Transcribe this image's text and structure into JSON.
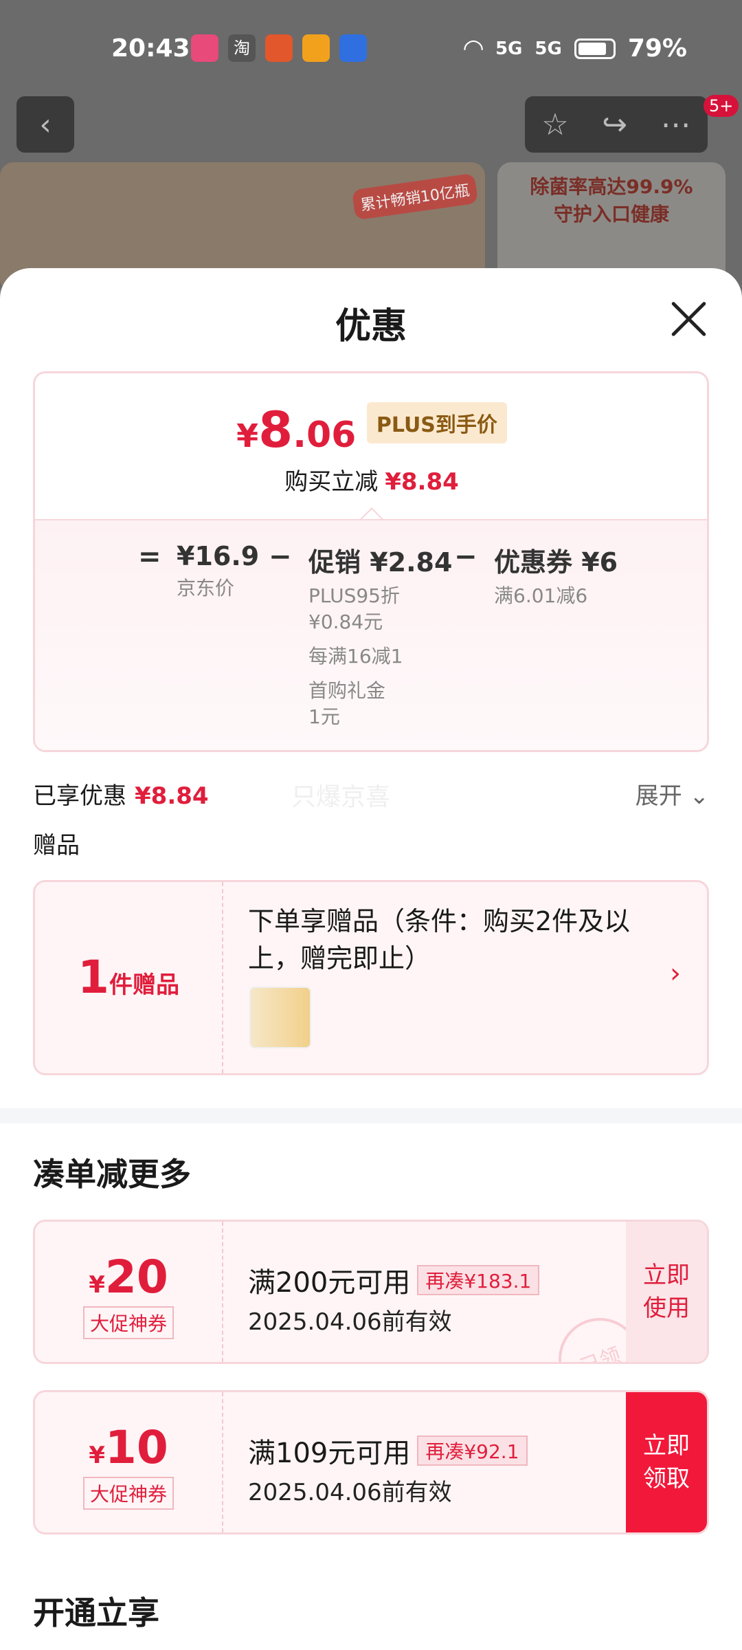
{
  "status": {
    "time": "20:43",
    "signal1": "5G",
    "signal2": "5G",
    "battery": "79%"
  },
  "background": {
    "badge": "5+",
    "banner_tag": "累计畅销10亿瓶",
    "banner_right_line1": "除菌率高达99.9%",
    "banner_right_line2": "守护入口健康"
  },
  "sheet": {
    "title": "优惠",
    "final_price": {
      "currency": "¥",
      "int": "8",
      "dec": ".06",
      "tag": "PLUS到手价"
    },
    "reduce_label": "购买立减",
    "reduce_amount": "¥8.84",
    "breakdown": {
      "eq": "=",
      "jd_price": "¥16.9",
      "jd_label": "京东价",
      "minus1": "−",
      "promo": "促销 ¥2.84",
      "promo_d1": "PLUS95折",
      "promo_d2": "¥0.84元",
      "promo_d3": "每满16减1",
      "promo_d4": "首购礼金",
      "promo_d5": "1元",
      "minus2": "−",
      "coupon": "优惠券 ¥6",
      "coupon_d1": "满6.01减6"
    },
    "enjoyed_label": "已享优惠",
    "enjoyed_amount": "¥8.84",
    "ghost_text": "只爆京喜",
    "expand_label": "展开 ⌄",
    "gifts_label": "赠品",
    "gift": {
      "count": "1",
      "unit": "件赠品",
      "desc": "下单享赠品（条件：购买2件及以上，赠完即止）",
      "chevron": "›"
    },
    "more_title": "凑单减更多",
    "coupons": [
      {
        "currency": "¥",
        "value": "20",
        "label": "大促神券",
        "cond": "满200元可用",
        "add": "再凑¥183.1",
        "expire": "2025.04.06前有效",
        "btn": "立即\n使用",
        "stamp": "已领"
      },
      {
        "currency": "¥",
        "value": "10",
        "label": "大促神券",
        "cond": "满109元可用",
        "add": "再凑¥92.1",
        "expire": "2025.04.06前有效",
        "btn": "立即\n领取"
      }
    ],
    "open_title": "开通立享"
  },
  "colors": {
    "accent": "#e01e3c",
    "plus_bg": "#fbe9cf",
    "card_border": "#f6d6db"
  }
}
